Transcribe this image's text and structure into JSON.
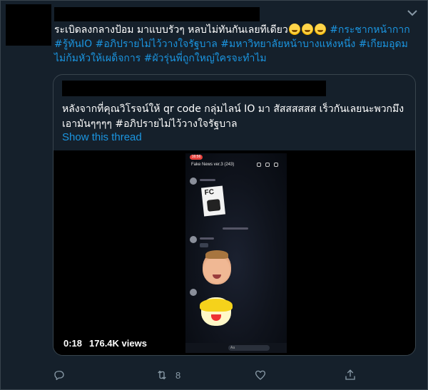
{
  "tweet": {
    "text_plain": "ระเบิดลงกลางป้อม มาแบบรัวๆ หลบไม่ทันกันเลยทีเดียว",
    "emoji_icons": [
      "rolling-laughing-emoji",
      "rolling-laughing-emoji",
      "rolling-laughing-emoji"
    ],
    "hashtags": [
      "#กระชากหน้ากาก",
      "#รู้ทันIO",
      "#อภิปรายไม่ไว้วางใจรัฐบาล",
      "#มหาวิทยาลัยหน้าบางแห่งหนึ่ง",
      "#เกียมอุดมไม่ก้มหัวให้เผด็จการ",
      "#ผัวรุ่นพี่ถูกใหญ่ใครจะทำไม"
    ]
  },
  "quote": {
    "text": "หลังจากที่คุณวิโรจน์ให้ qr code กลุ่มไลน์ IO มา สัสสสสสส เร็วกันเลยนะพวกมึงเอามันๆๆๆๆ #อภิปรายไม่ไว้วางใจรัฐบาล",
    "show_thread": "Show this thread"
  },
  "video": {
    "duration": "0:18",
    "views": "176.4K views",
    "phone": {
      "status_time": "16:56",
      "chat_title": "Fake News ver.3 (243)",
      "input_placeholder": "Aa"
    }
  },
  "actions": {
    "reply": {
      "icon": "reply-icon",
      "count": ""
    },
    "retweet": {
      "icon": "retweet-icon",
      "count": "8"
    },
    "like": {
      "icon": "heart-icon",
      "count": ""
    },
    "share": {
      "icon": "share-icon",
      "count": ""
    }
  },
  "colors": {
    "background": "#15202b",
    "border": "#38444d",
    "hashtag": "#1b95e0",
    "text": "#ffffff",
    "muted": "#8899a6"
  }
}
